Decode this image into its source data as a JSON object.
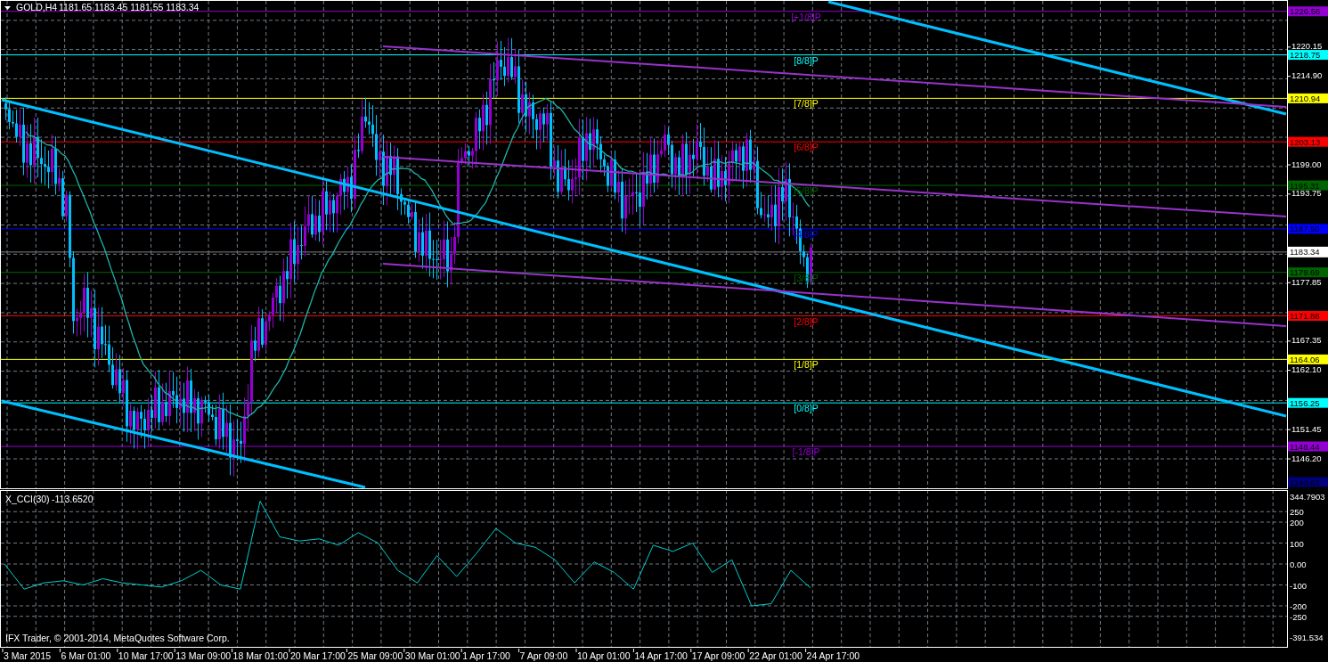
{
  "chart_header": {
    "symbol": "GOLD,H4",
    "quote": "1181.65 1183.45 1181.55 1183.34"
  },
  "price_axis": {
    "ticks": [
      "1220.15",
      "1214.90",
      "1199.00",
      "1193.75",
      "1177.85",
      "1167.35",
      "1162.10",
      "1151.45",
      "1146.20"
    ]
  },
  "murrey_levels": [
    {
      "label": "[+1/8]P",
      "price": "1226.56",
      "color": "#9400d3"
    },
    {
      "label": "[8/8]P",
      "price": "1218.75",
      "color": "#00ffff"
    },
    {
      "label": "[7/8]P",
      "price": "1210.94",
      "color": "#ffff00"
    },
    {
      "label": "[6/8]P",
      "price": "1203.13",
      "color": "#ff0000"
    },
    {
      "label": "[5/8]P",
      "price": "1195.31",
      "color": "#006400"
    },
    {
      "label": "[4/8]P",
      "price": "1187.50",
      "color": "#0000ff"
    },
    {
      "label": "[3/8]P",
      "price": "1179.69",
      "color": "#006400"
    },
    {
      "label": "[2/8]P",
      "price": "1171.88",
      "color": "#ff0000"
    },
    {
      "label": "[1/8]P",
      "price": "1164.06",
      "color": "#ffff00"
    },
    {
      "label": "[0/8]P",
      "price": "1156.25",
      "color": "#00ffff"
    },
    {
      "label": "[-1/8]P",
      "price": "1148.44",
      "color": "#9400d3"
    },
    {
      "price": "1140.63",
      "color": "#000080"
    }
  ],
  "current_price": "1183.34",
  "indicator": {
    "value": "-113.6520",
    "chart_data": {
      "type": "line",
      "grid": true,
      "ylim": [
        -391.534,
        344.7903
      ],
      "yticks": [
        {
          "value": 344.7903,
          "label": "344.7903"
        },
        {
          "value": 250,
          "label": "250"
        },
        {
          "value": 200,
          "label": "200"
        },
        {
          "value": 100,
          "label": "100"
        },
        {
          "value": 0,
          "label": "0.00"
        },
        {
          "value": -100,
          "label": "-100"
        },
        {
          "value": -200,
          "label": "-200"
        },
        {
          "value": -250,
          "label": "-250"
        },
        {
          "value": -391.534,
          "label": "-391.534"
        }
      ],
      "series": [
        {
          "name": "X_CCI(30)",
          "color": "#00ced1",
          "values": [
            0,
            -120,
            -90,
            -80,
            -100,
            -70,
            -90,
            -100,
            -110,
            -80,
            -30,
            -100,
            -120,
            300,
            130,
            110,
            120,
            90,
            150,
            100,
            -30,
            -90,
            40,
            -60,
            50,
            170,
            100,
            80,
            20,
            -90,
            10,
            -40,
            -120,
            90,
            60,
            100,
            -40,
            20,
            -200,
            -190,
            -30,
            -114
          ]
        }
      ]
    }
  },
  "copyright": "IFX Trader, © 2001-2014, MetaQuotes Software Corp.",
  "time_axis": [
    "3 Mar 2015",
    "6 Mar 01:00",
    "10 Mar 17:00",
    "13 Mar 09:00",
    "18 Mar 01:00",
    "20 Mar 17:00",
    "25 Mar 09:00",
    "30 Mar 01:00",
    "1 Apr 17:00",
    "7 Apr 09:00",
    "10 Apr 01:00",
    "14 Apr 17:00",
    "17 Apr 09:00",
    "22 Apr 01:00",
    "24 Apr 17:00"
  ]
}
